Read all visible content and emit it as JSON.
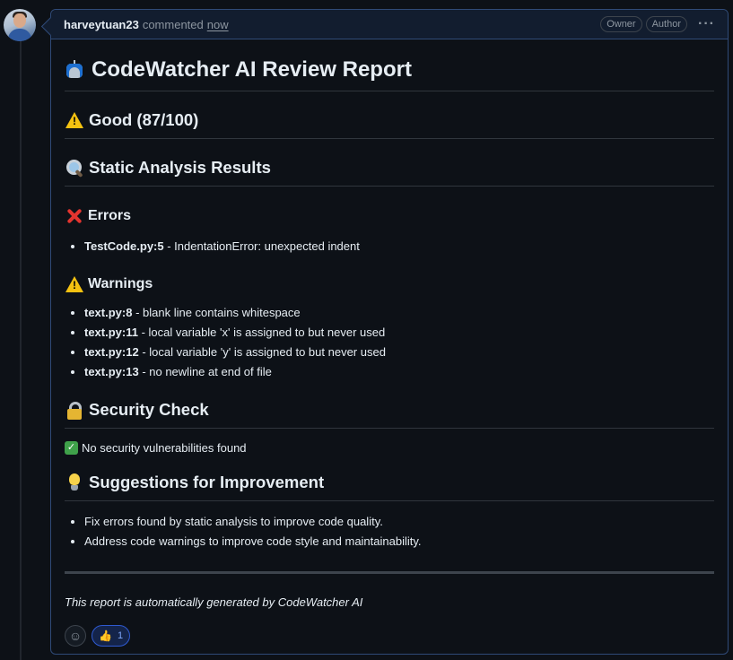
{
  "comment": {
    "author": "harveytuan23",
    "action": "commented",
    "time": "now",
    "badges": [
      "Owner",
      "Author"
    ],
    "menu_icon": "kebab-horizontal-icon"
  },
  "report": {
    "title": "CodeWatcher AI Review Report",
    "score_heading": "Good (87/100)",
    "static_heading": "Static Analysis Results",
    "errors_heading": "Errors",
    "errors": [
      {
        "file": "TestCode.py:5",
        "message": " - IndentationError: unexpected indent"
      }
    ],
    "warnings_heading": "Warnings",
    "warnings": [
      {
        "file": "text.py:8",
        "message": " - blank line contains whitespace"
      },
      {
        "file": "text.py:11",
        "message": " - local variable 'x' is assigned to but never used"
      },
      {
        "file": "text.py:12",
        "message": " - local variable 'y' is assigned to but never used"
      },
      {
        "file": "text.py:13",
        "message": " - no newline at end of file"
      }
    ],
    "security_heading": "Security Check",
    "security_result": "No security vulnerabilities found",
    "suggestions_heading": "Suggestions for Improvement",
    "suggestions": [
      "Fix errors found by static analysis to improve code quality.",
      "Address code warnings to improve code style and maintainability."
    ],
    "footer": "This report is automatically generated by CodeWatcher AI"
  },
  "reactions": {
    "add_icon": "smiley-icon",
    "thumbs_up_count": "1"
  },
  "colors": {
    "background": "#0d1117",
    "border_accent": "#2f4a77",
    "text": "#e6edf3",
    "muted": "#8d96a0"
  }
}
